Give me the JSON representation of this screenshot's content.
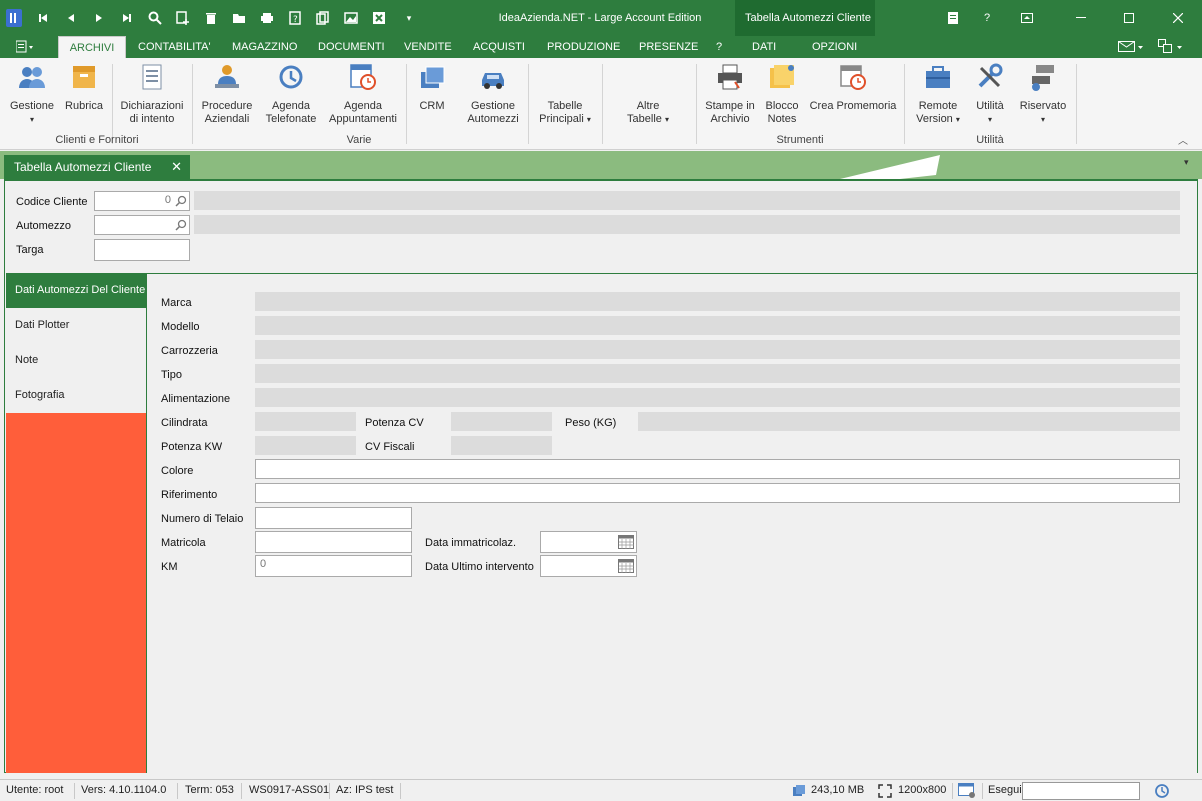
{
  "app": {
    "title": "IdeaAzienda.NET - Large Account Edition",
    "context_title": "Tabella Automezzi Cliente",
    "accent": "#2e7d3e"
  },
  "ribbon_tabs": [
    "ARCHIVI",
    "CONTABILITA'",
    "MAGAZZINO",
    "DOCUMENTI",
    "VENDITE",
    "ACQUISTI",
    "PRODUZIONE",
    "PRESENZE",
    "?",
    "DATI",
    "OPZIONI"
  ],
  "ribbon": {
    "gestione": "Gestione",
    "rubrica": "Rubrica",
    "dichiarazioni": [
      "Dichiarazioni",
      "di intento"
    ],
    "procedure": [
      "Procedure",
      "Aziendali"
    ],
    "agenda_tel": [
      "Agenda",
      "Telefonate"
    ],
    "agenda_app": [
      "Agenda",
      "Appuntamenti"
    ],
    "crm": "CRM",
    "gestione_automezzi": [
      "Gestione",
      "Automezzi"
    ],
    "tabelle_principali": [
      "Tabelle",
      "Principali"
    ],
    "altre_tabelle": [
      "Altre",
      "Tabelle"
    ],
    "stampe": [
      "Stampe in",
      "Archivio"
    ],
    "blocco": [
      "Blocco",
      "Notes"
    ],
    "promemoria": "Crea Promemoria",
    "remote": [
      "Remote",
      "Version"
    ],
    "utilita": "Utilità",
    "riservato": "Riservato",
    "groups": {
      "clienti": "Clienti e Fornitori",
      "varie": "Varie",
      "strumenti": "Strumenti",
      "utilita": "Utilità"
    }
  },
  "doc_tab": "Tabella Automezzi Cliente",
  "header_fields": {
    "codice_cliente": "Codice Cliente",
    "codice_value": "0",
    "automezzo": "Automezzo",
    "targa": "Targa"
  },
  "side_tabs": [
    "Dati Automezzi Del Cliente",
    "Dati Plotter",
    "Note",
    "Fotografia"
  ],
  "form": {
    "marca": "Marca",
    "modello": "Modello",
    "carrozzeria": "Carrozzeria",
    "tipo": "Tipo",
    "alimentazione": "Alimentazione",
    "cilindrata": "Cilindrata",
    "potenza_cv": "Potenza CV",
    "peso": "Peso (KG)",
    "potenza_kw": "Potenza KW",
    "cv_fiscali": "CV Fiscali",
    "colore": "Colore",
    "riferimento": "Riferimento",
    "telaio": "Numero di Telaio",
    "matricola": "Matricola",
    "data_immatricolaz": "Data immatricolaz.",
    "km": "KM",
    "km_value": "0",
    "data_ultimo": "Data Ultimo intervento"
  },
  "status": {
    "utente": "Utente: root",
    "vers": "Vers: 4.10.1104.0",
    "term": "Term: 053",
    "ws": "WS0917-ASS01",
    "az": "Az: IPS test",
    "mem": "243,10 MB",
    "res": "1200x800",
    "esegui": "Esegui"
  }
}
